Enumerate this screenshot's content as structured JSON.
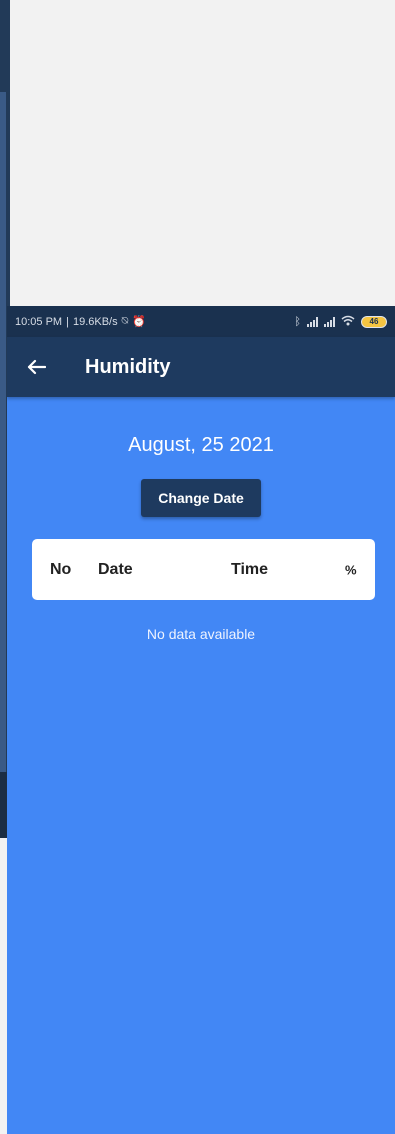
{
  "status_bar": {
    "time": "10:05 PM",
    "speed": "19.6KB/s",
    "battery": "46"
  },
  "app_bar": {
    "title": "Humidity",
    "back_icon": "arrow-left-icon"
  },
  "content": {
    "date": "August, 25 2021",
    "change_button": "Change Date",
    "table_headers": [
      "No",
      "Date",
      "Time",
      "%"
    ],
    "empty_text": "No data available"
  },
  "colors": {
    "accent": "#4287f5",
    "app_bar": "#1e3a5f",
    "status_bar": "#1a314f",
    "button": "#1e3a5f"
  }
}
